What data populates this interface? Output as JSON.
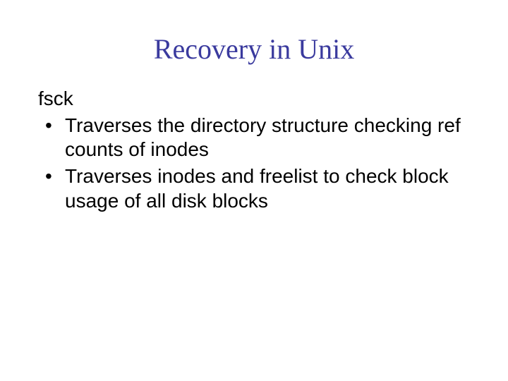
{
  "title": "Recovery in Unix",
  "subhead": "fsck",
  "bullets": [
    "Traverses the directory structure checking ref counts of inodes",
    "Traverses inodes and freelist to check block usage of all disk blocks"
  ]
}
